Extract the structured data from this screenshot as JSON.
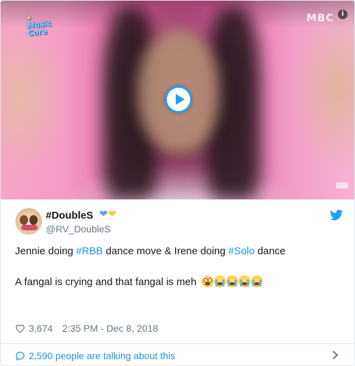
{
  "video": {
    "show_logo": "Music Core",
    "broadcaster_logo": "MBC",
    "info_symbol": "i",
    "play_icon": "play-icon"
  },
  "tweet": {
    "display_name": "#DoubleS",
    "name_emojis": [
      "blue-heart",
      "yellow-heart"
    ],
    "handle": "@RV_DoubleS",
    "line1": {
      "t1": "Jennie doing ",
      "h1": "#RBB",
      "t2": " dance move & Irene doing ",
      "h2": "#Solo",
      "t3": " dance"
    },
    "line2": "A fangal is crying and that fangal is meh",
    "line2_emojis": [
      "face-with-rolling-eyes",
      "loudly-crying-face",
      "loudly-crying-face",
      "loudly-crying-face",
      "loudly-crying-face"
    ],
    "likes": "3,674",
    "timestamp": "2:35 PM - Dec 8, 2018",
    "talking": "2,590 people are talking about this"
  },
  "colors": {
    "accent": "#1da1f2",
    "link": "#1b95e0",
    "muted": "#657786",
    "text": "#14171a",
    "border": "#e1e8ed"
  }
}
